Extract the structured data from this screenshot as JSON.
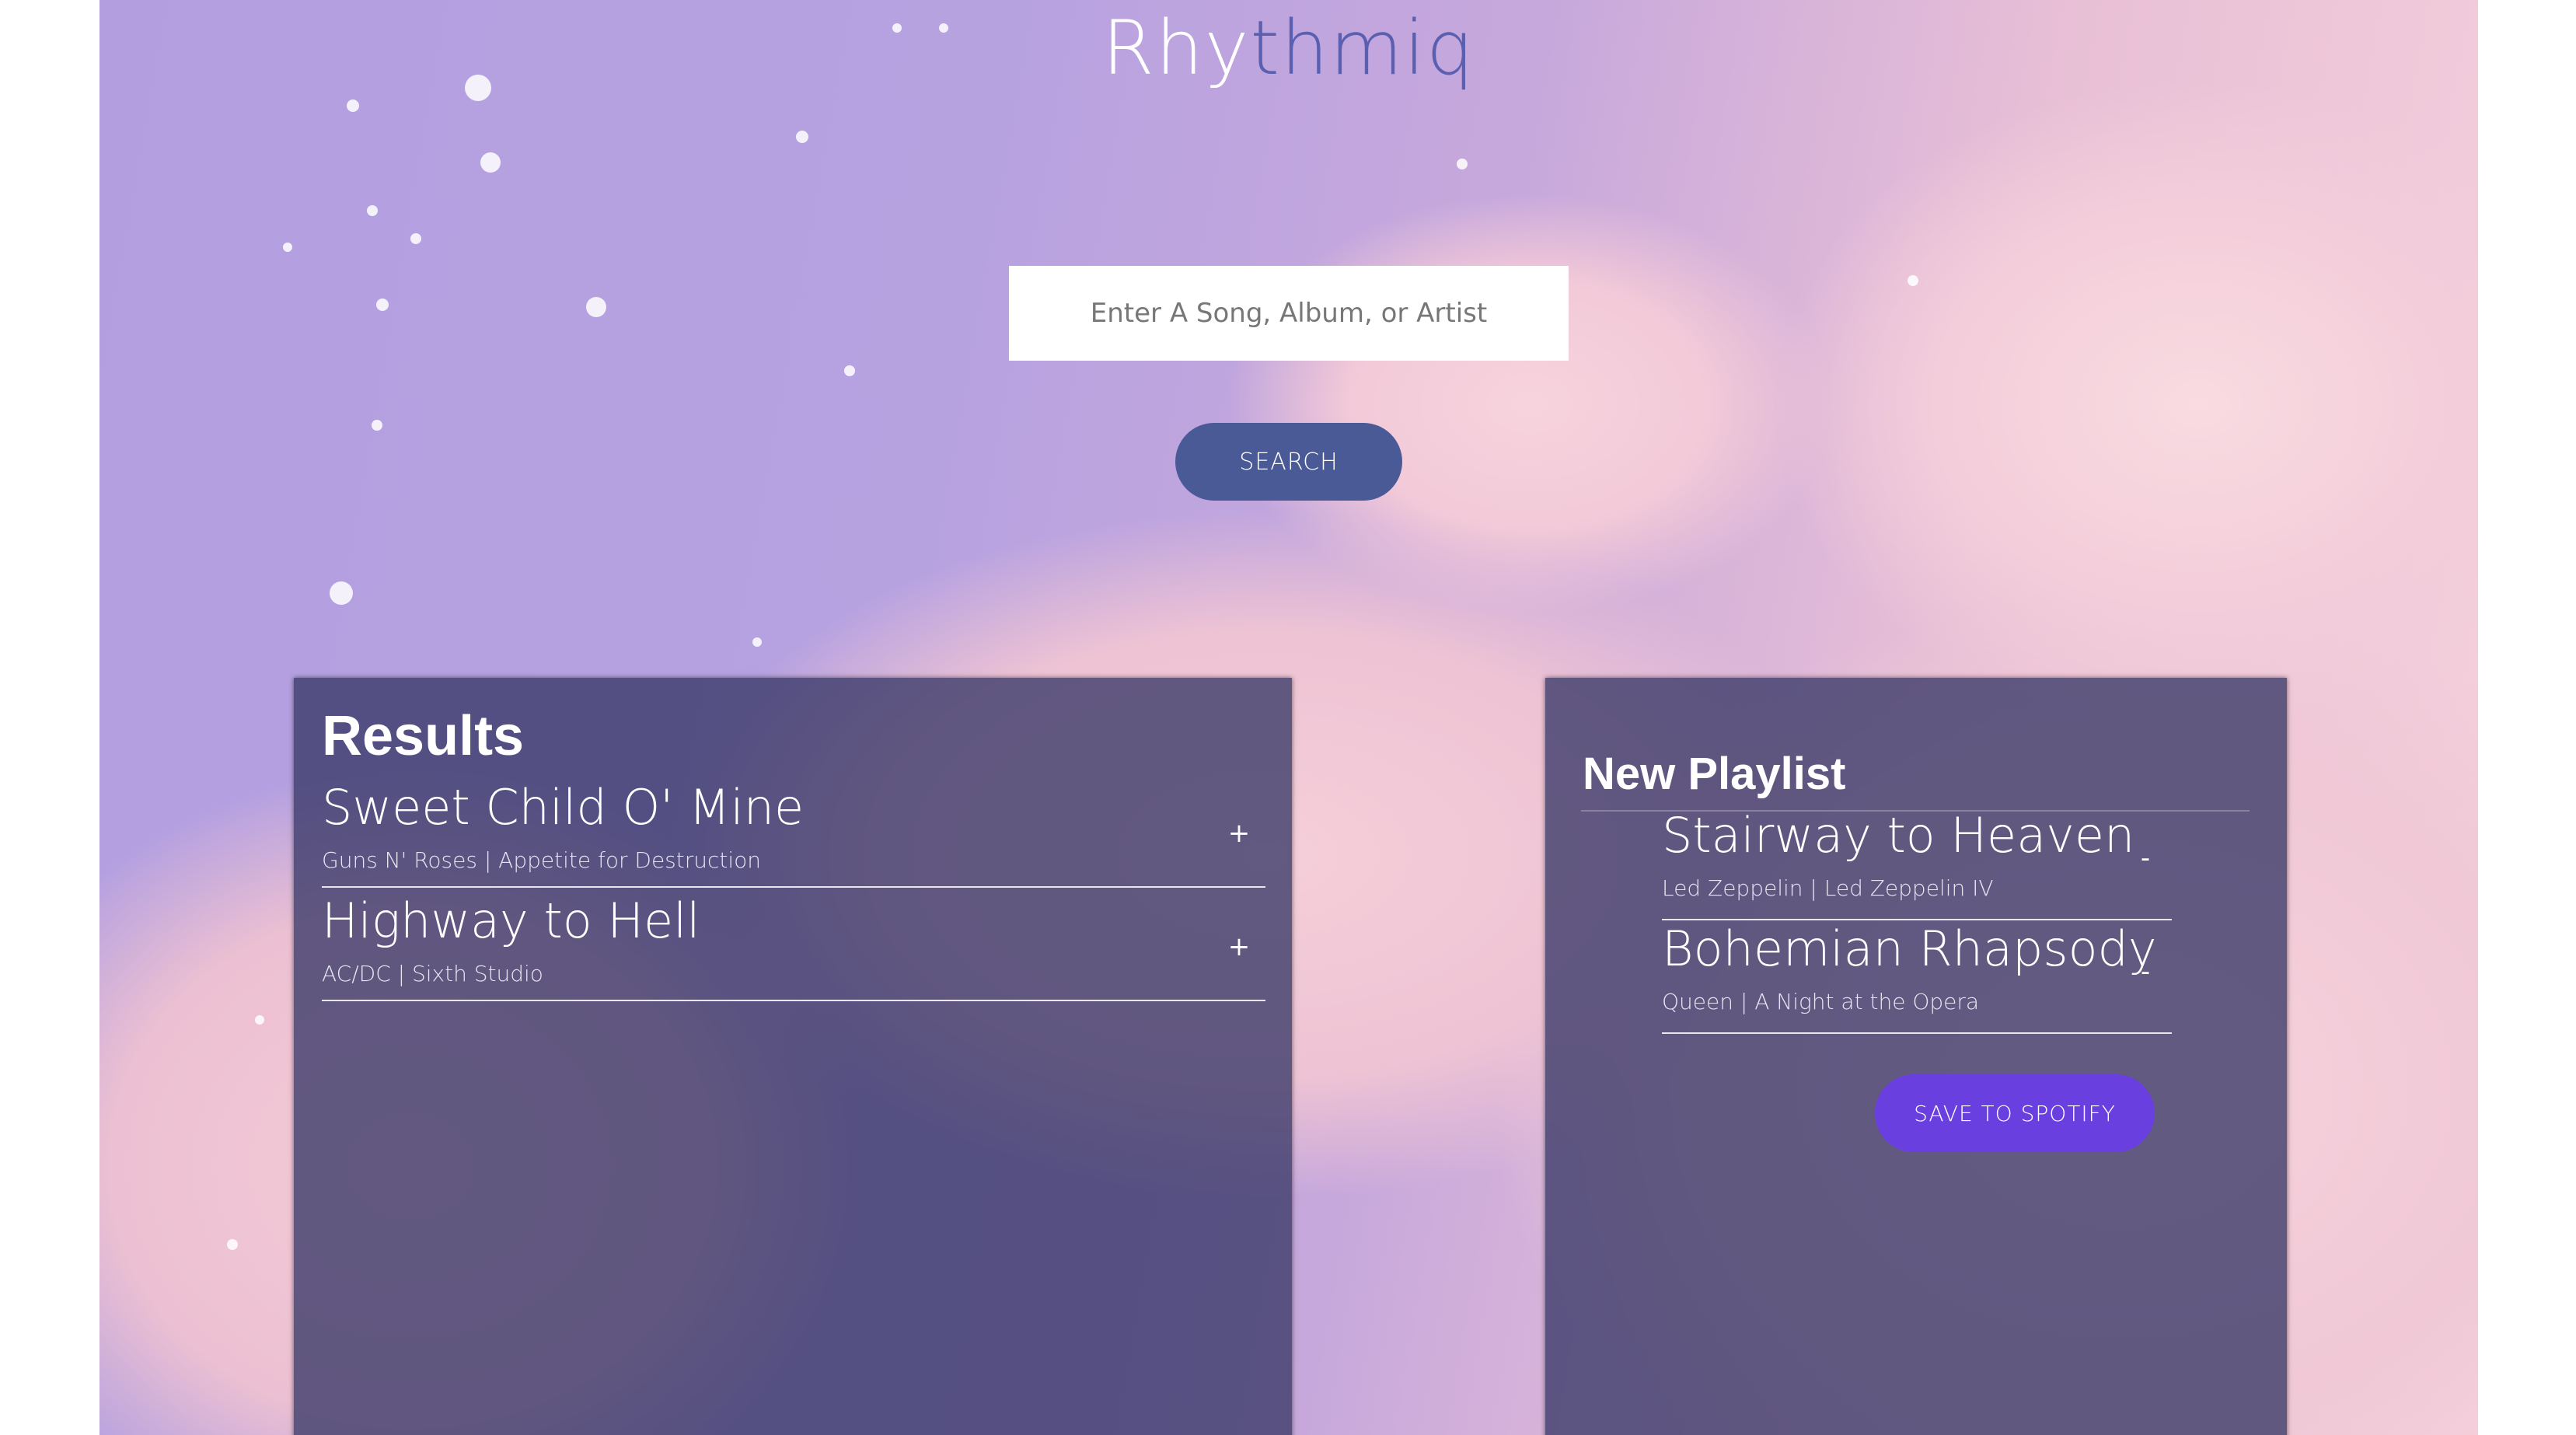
{
  "app": {
    "brand_part1": "Rhy",
    "brand_part2": "thmiq"
  },
  "search": {
    "placeholder": "Enter A Song, Album, or Artist",
    "value": "",
    "button_label": "SEARCH"
  },
  "results": {
    "title": "Results",
    "tracks": [
      {
        "name": "Sweet Child O' Mine",
        "meta": "Guns N' Roses | Appetite for Destruction",
        "action": "+"
      },
      {
        "name": "Highway to Hell",
        "meta": "AC/DC | Sixth Studio",
        "action": "+"
      }
    ]
  },
  "playlist": {
    "title": "New Playlist",
    "tracks": [
      {
        "name": "Stairway to Heaven",
        "meta": "Led Zeppelin | Led Zeppelin IV",
        "action": "-"
      },
      {
        "name": "Bohemian Rhapsody",
        "meta": "Queen | A Night at the Opera",
        "action": "-"
      }
    ],
    "save_label": "SAVE TO SPOTIFY"
  },
  "colors": {
    "search_button": "#4a5a96",
    "save_button": "#6a3fe0",
    "panel": "#383968"
  }
}
